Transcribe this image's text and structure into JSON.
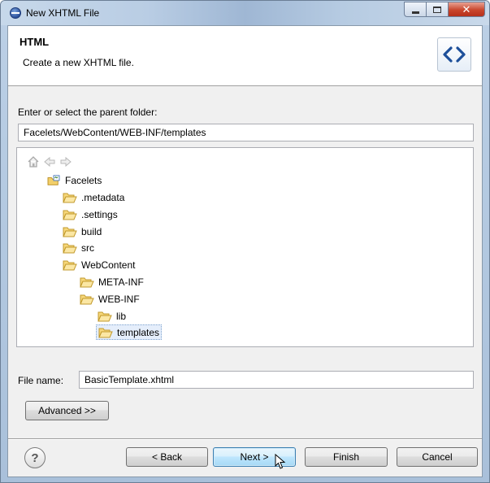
{
  "window": {
    "title": "New XHTML File",
    "close_glyph": "✕"
  },
  "banner": {
    "title": "HTML",
    "description": "Create a new XHTML file.",
    "icon": "xhtml-code-icon"
  },
  "folder_section": {
    "label": "Enter or select the parent folder:",
    "value": "Facelets/WebContent/WEB-INF/templates"
  },
  "tree": {
    "nav_icons": [
      "home-icon",
      "back-arrow-icon",
      "forward-arrow-icon"
    ],
    "nodes": [
      {
        "label": "Facelets",
        "icon": "project-icon",
        "depth": 0,
        "selected": false
      },
      {
        "label": ".metadata",
        "icon": "folder-icon",
        "depth": 1,
        "selected": false
      },
      {
        "label": ".settings",
        "icon": "folder-icon",
        "depth": 1,
        "selected": false
      },
      {
        "label": "build",
        "icon": "folder-icon",
        "depth": 1,
        "selected": false
      },
      {
        "label": "src",
        "icon": "folder-icon",
        "depth": 1,
        "selected": false
      },
      {
        "label": "WebContent",
        "icon": "folder-icon",
        "depth": 1,
        "selected": false
      },
      {
        "label": "META-INF",
        "icon": "folder-icon",
        "depth": 2,
        "selected": false
      },
      {
        "label": "WEB-INF",
        "icon": "folder-icon",
        "depth": 2,
        "selected": false
      },
      {
        "label": "lib",
        "icon": "folder-icon",
        "depth": 3,
        "selected": false
      },
      {
        "label": "templates",
        "icon": "folder-icon",
        "depth": 3,
        "selected": true
      }
    ]
  },
  "file_name": {
    "label": "File name:",
    "value": "BasicTemplate.xhtml"
  },
  "buttons": {
    "advanced": "Advanced >>",
    "help": "?",
    "back": "< Back",
    "next": "Next >",
    "finish": "Finish",
    "cancel": "Cancel"
  },
  "colors": {
    "selection_bg": "#e5eefb",
    "folder_fill": "#f6d77a",
    "default_button_border": "#3c7fb1"
  }
}
